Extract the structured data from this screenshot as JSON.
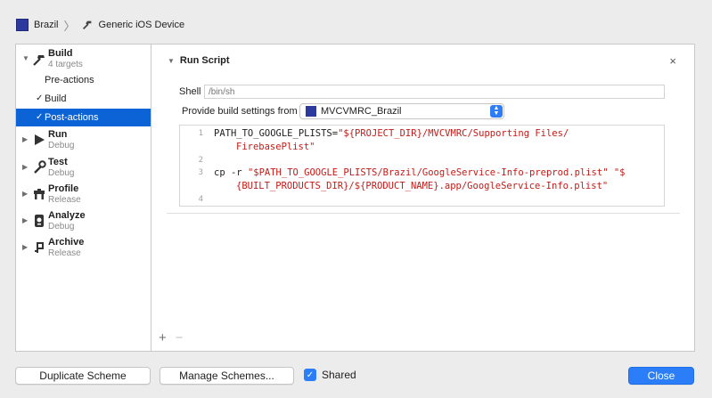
{
  "topbar": {
    "scheme": "Brazil",
    "destination": "Generic iOS Device",
    "scheme_color": "#2b3a9c"
  },
  "sidebar": {
    "build": {
      "title": "Build",
      "subtitle": "4 targets",
      "icon": "hammer-icon"
    },
    "build_items": [
      {
        "label": "Pre-actions",
        "checked": false,
        "selected": false
      },
      {
        "label": "Build",
        "checked": true,
        "selected": false
      },
      {
        "label": "Post-actions",
        "checked": true,
        "selected": true
      }
    ],
    "groups": [
      {
        "title": "Run",
        "subtitle": "Debug",
        "icon": "play-icon"
      },
      {
        "title": "Test",
        "subtitle": "Debug",
        "icon": "wrench-icon"
      },
      {
        "title": "Profile",
        "subtitle": "Release",
        "icon": "instruments-icon"
      },
      {
        "title": "Analyze",
        "subtitle": "Debug",
        "icon": "analyze-icon"
      },
      {
        "title": "Archive",
        "subtitle": "Release",
        "icon": "archive-icon"
      }
    ],
    "selected_color": "#0b63d6"
  },
  "run_script": {
    "title": "Run Script",
    "close_glyph": "×",
    "shell_label": "Shell",
    "shell_placeholder": "/bin/sh",
    "provide_label": "Provide build settings from",
    "provide_value": "MVCVMRC_Brazil",
    "code_lines": [
      {
        "num": "1",
        "pre": "PATH_TO_GOOGLE_PLISTS=",
        "str": "\"${PROJECT_DIR}/MVCVMRC/Supporting Files/",
        "cont": "FirebasePlist\""
      },
      {
        "num": "2",
        "pre": "",
        "str": "",
        "cont": ""
      },
      {
        "num": "3",
        "pre": "cp -r ",
        "str": "\"$PATH_TO_GOOGLE_PLISTS/Brazil/GoogleService-Info-preprod.plist\" \"$",
        "cont": "{BUILT_PRODUCTS_DIR}/${PRODUCT_NAME}.app/GoogleService-Info.plist\""
      },
      {
        "num": "4",
        "pre": "",
        "str": "",
        "cont": ""
      }
    ],
    "string_color": "#c41a16"
  },
  "footer": {
    "duplicate": "Duplicate Scheme",
    "manage": "Manage Schemes...",
    "shared_label": "Shared",
    "shared_checked": true,
    "close": "Close",
    "add_glyph": "+",
    "remove_glyph": "−"
  }
}
